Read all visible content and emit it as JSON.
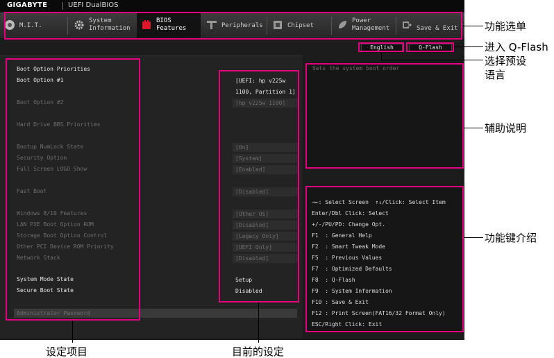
{
  "header": {
    "brand": "GIGABYTE",
    "product": "UEFI DualBIOS"
  },
  "menu": {
    "tabs": [
      {
        "label": "M.I.T.",
        "icon": "mit-disc-icon"
      },
      {
        "label": "System\nInformation",
        "icon": "gear-icon"
      },
      {
        "label": "BIOS\nFeatures",
        "icon": "bios-chip-icon",
        "active": true
      },
      {
        "label": "Peripherals",
        "icon": "peripherals-icon"
      },
      {
        "label": "Chipset",
        "icon": "chipset-icon"
      },
      {
        "label": "Power\nManagement",
        "icon": "power-icon"
      },
      {
        "label": "Save & Exit",
        "icon": "exit-icon"
      }
    ]
  },
  "toolbar": {
    "language": "English",
    "qflash": "Q-Flash"
  },
  "settings": [
    {
      "label": "Boot Option Priorities",
      "bright": true
    },
    {
      "label": "Boot Option #1",
      "bright": true,
      "value": "[UEFI: hp v225w",
      "value2": "1100, Partition 1]"
    },
    {
      "label": "Boot Option #2",
      "value": "[hp v225w 1100]"
    },
    {
      "label": "Hard Drive BBS Priorities"
    },
    {
      "label": "Bootup NumLock State",
      "value": "[On]"
    },
    {
      "label": "Security Option",
      "value": "[System]"
    },
    {
      "label": "Full Screen LOGO Show",
      "value": "[Enabled]"
    },
    {
      "label": "Fast Boot",
      "value": "[Disabled]"
    },
    {
      "label": "Windows 8/10 Features",
      "value": "[Other OS]"
    },
    {
      "label": "LAN PXE Boot Option ROM",
      "value": "[Disabled]"
    },
    {
      "label": "Storage Boot Option Control",
      "value": "[Legacy Only]"
    },
    {
      "label": "Other PCI Device ROM Priority",
      "value": "[UEFI Only]"
    },
    {
      "label": "Network Stack",
      "value": "[Disabled]"
    },
    {
      "label": "System Mode State",
      "bright": true,
      "value": "Setup"
    },
    {
      "label": "Secure Boot State",
      "bright": true,
      "value": "Disabled"
    },
    {
      "label": "Administrator Password"
    }
  ],
  "help": {
    "text": "Sets the system boot order"
  },
  "keys": [
    "→←: Select Screen  ↑↓/Click: Select Item",
    "Enter/Dbl Click: Select",
    "+/-/PU/PD: Change Opt.",
    "F1  : General Help",
    "F2  : Smart Tweak Mode",
    "F5  : Previous Values",
    "F7  : Optimized Defaults",
    "F8  : Q-Flash",
    "F9  : System Information",
    "F10 : Save & Exit",
    "F12 : Print Screen(FAT16/32 Format Only)",
    "ESC/Right Click: Exit"
  ],
  "annotations": {
    "menu": "功能选单",
    "qflash": "进入 Q-Flash",
    "language_1": "选择预设",
    "language_2": "语言",
    "help": "辅助说明",
    "keys": "功能键介绍",
    "items": "设定项目",
    "current": "目前的设定"
  },
  "colors": {
    "highlight": "#e5007e",
    "bios_bg": "#1c1c1c",
    "active_tab_icon": "#e0172b"
  }
}
